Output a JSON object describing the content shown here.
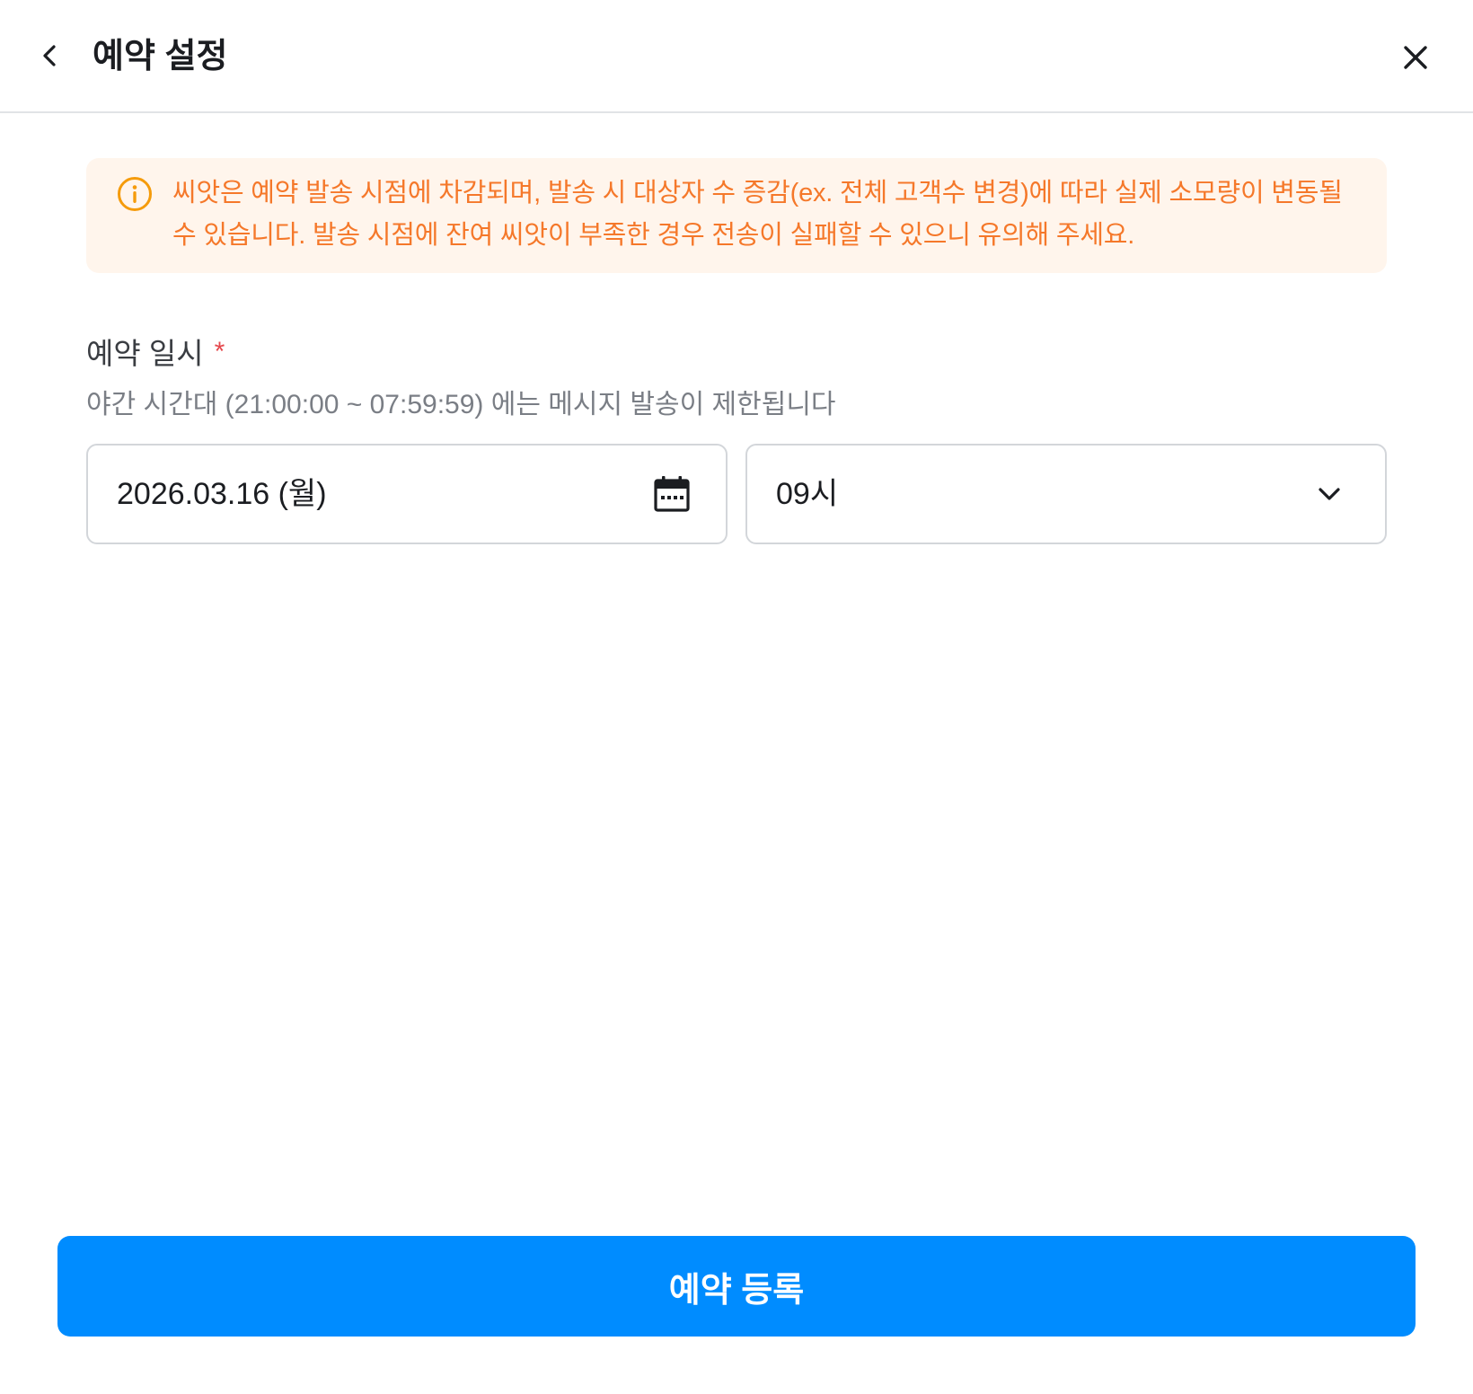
{
  "header": {
    "title": "예약 설정",
    "back_icon": "chevron-left-icon",
    "close_icon": "close-icon"
  },
  "notice": {
    "icon": "info-icon",
    "text": "씨앗은 예약 발송 시점에 차감되며, 발송 시 대상자 수 증감(ex. 전체 고객수 변경)에 따라 실제 소모량이 변동될 수 있습니다. 발송 시점에 잔여 씨앗이 부족한 경우 전송이 실패할 수 있으니 유의해 주세요.",
    "color": "#f5782a",
    "background": "#fff5ec"
  },
  "schedule": {
    "label": "예약 일시",
    "required_mark": "*",
    "help_text": "야간 시간대 (21:00:00 ~ 07:59:59) 에는 메시지 발송이 제한됩니다",
    "date_value": "2026.03.16 (월)",
    "date_icon": "calendar-icon",
    "hour_value": "09시",
    "hour_icon": "chevron-down-icon"
  },
  "footer": {
    "submit_label": "예약 등록",
    "accent": "#008cff"
  }
}
